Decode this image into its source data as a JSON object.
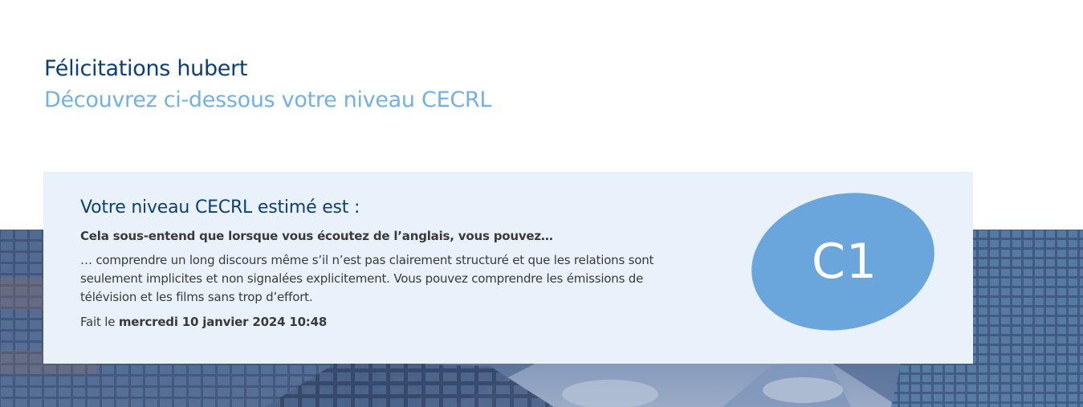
{
  "header": {
    "title": "Félicitations hubert",
    "subtitle": "Découvrez ci-dessous votre niveau CECRL"
  },
  "result": {
    "title": "Votre niveau CECRL estimé est :",
    "intro": "Cela sous-entend que lorsque vous écoutez de l’anglais, vous pouvez…",
    "description": "… comprendre un long discours même s’il n’est pas clairement structuré et que les relations sont seulement implicites et non signalées explicitement. Vous pouvez comprendre les émissions de télévision et les films sans trop d’effort.",
    "date_prefix": "Fait le",
    "date_value": "mercredi 10 janvier 2024 10:48",
    "level": "C1"
  },
  "colors": {
    "title": "#0d3f73",
    "subtitle": "#72b0e8",
    "card_background": "#e9f2fb",
    "badge": "#6aa5db",
    "body_text": "#3a3a3a"
  }
}
